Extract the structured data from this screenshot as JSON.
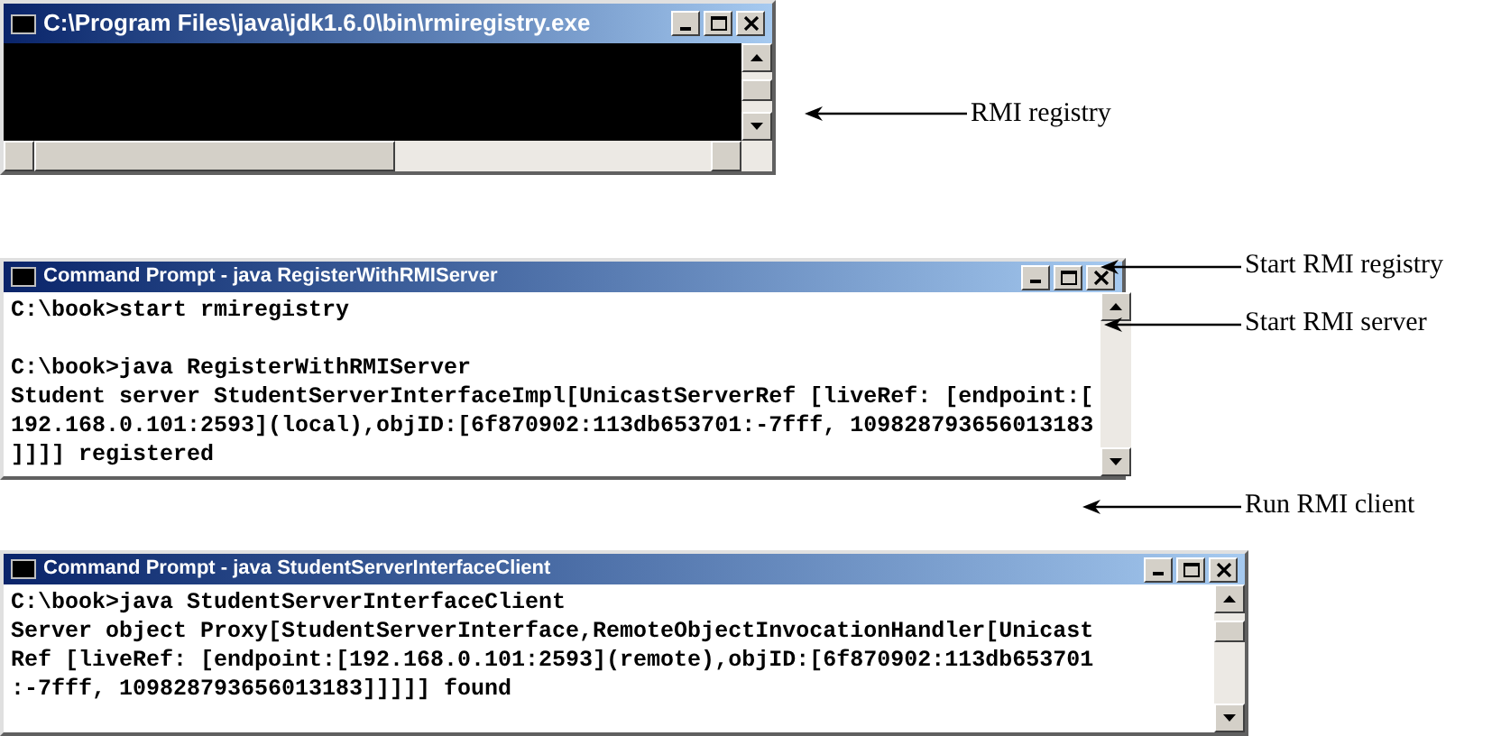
{
  "windows": [
    {
      "kind": "empty",
      "title": "C:\\Program Files\\java\\jdk1.6.0\\bin\\rmiregistry.exe"
    },
    {
      "kind": "text",
      "title": "Command Prompt - java RegisterWithRMIServer",
      "lines": [
        {
          "text": "C:\\book>start rmiregistry",
          "blank_line_before": false
        },
        {
          "text": "C:\\book>java RegisterWithRMIServer",
          "blank_line_before": true
        },
        {
          "text": "Student server StudentServerInterfaceImpl[UnicastServerRef [liveRef: [endpoint:[",
          "blank_line_before": false
        },
        {
          "text": "192.168.0.101:2593](local),objID:[6f870902:113db653701:-7fff, 109828793656013183",
          "blank_line_before": false
        },
        {
          "text": "]]]] registered",
          "blank_line_before": false
        }
      ]
    },
    {
      "kind": "text",
      "title": "Command Prompt - java StudentServerInterfaceClient",
      "lines": [
        {
          "text": "C:\\book>java StudentServerInterfaceClient",
          "blank_line_before": false
        },
        {
          "text": "Server object Proxy[StudentServerInterface,RemoteObjectInvocationHandler[Unicast",
          "blank_line_before": false
        },
        {
          "text": "Ref [liveRef: [endpoint:[192.168.0.101:2593](remote),objID:[6f870902:113db653701",
          "blank_line_before": false
        },
        {
          "text": ":-7fff, 109828793656013183]]]]] found",
          "blank_line_before": false
        }
      ]
    }
  ],
  "annotations": [
    {
      "label": "RMI registry"
    },
    {
      "label": "Start RMI registry"
    },
    {
      "label": "Start RMI server"
    },
    {
      "label": "Run RMI client"
    }
  ]
}
